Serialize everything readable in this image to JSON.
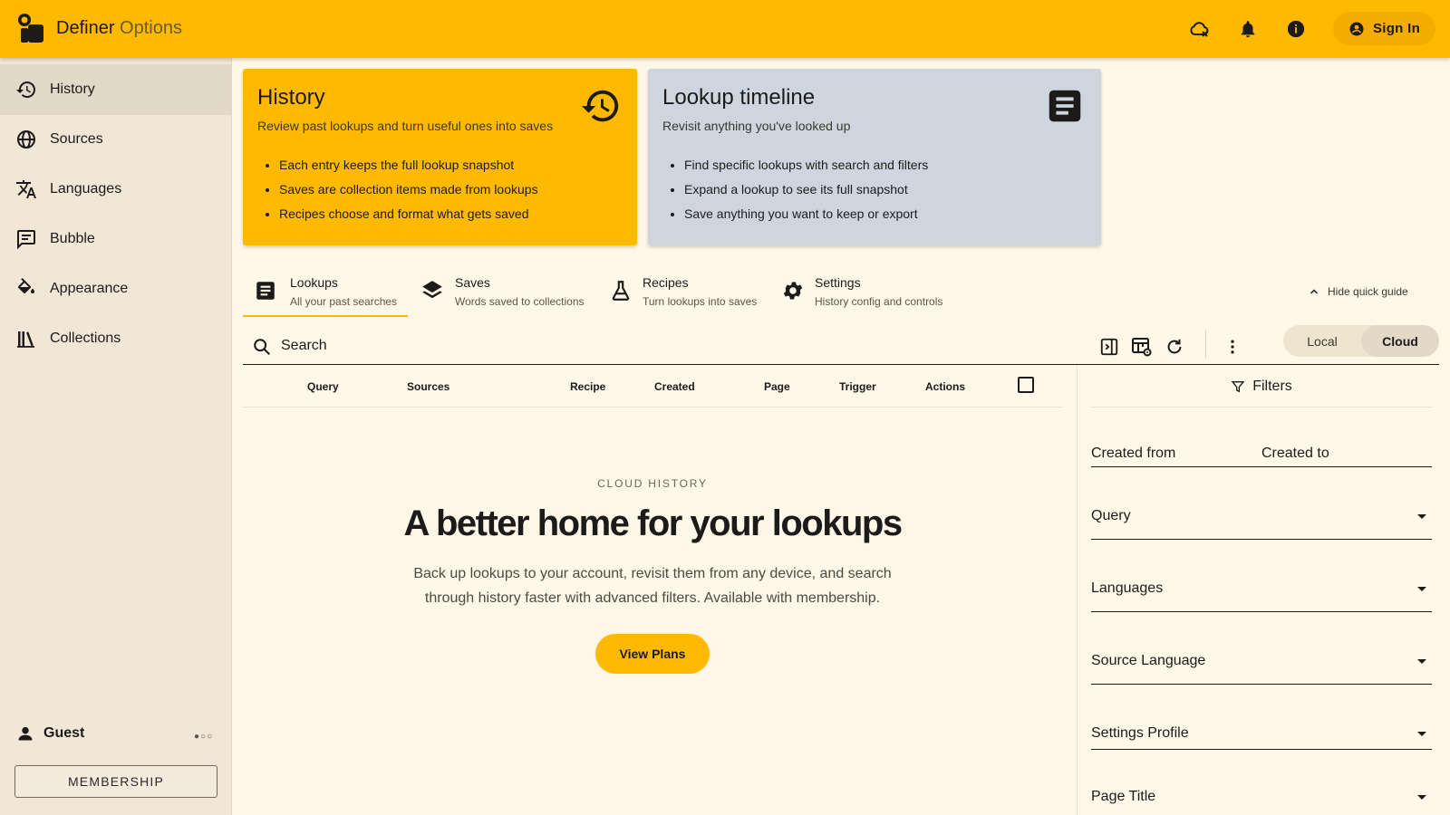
{
  "header": {
    "app_name": "Definer",
    "app_sub": "Options",
    "sign_in_label": "Sign In",
    "icons": [
      "cloud-off-icon",
      "bell-icon",
      "info-icon",
      "account-circle-icon"
    ]
  },
  "sidebar": {
    "items": [
      {
        "label": "History",
        "icon": "history-icon",
        "active": true
      },
      {
        "label": "Sources",
        "icon": "globe-icon"
      },
      {
        "label": "Languages",
        "icon": "translate-icon"
      },
      {
        "label": "Bubble",
        "icon": "chat-bubble-icon"
      },
      {
        "label": "Appearance",
        "icon": "paint-bucket-icon"
      },
      {
        "label": "Collections",
        "icon": "library-icon"
      }
    ],
    "user_name": "Guest",
    "membership_label": "MEMBERSHIP"
  },
  "cards": {
    "history": {
      "title": "History",
      "description": "Review past lookups and turn useful ones into saves",
      "bullets": [
        "Each entry keeps the full lookup snapshot",
        "Saves are collection items made from lookups",
        "Recipes choose and format what gets saved"
      ]
    },
    "timeline": {
      "title": "Lookup timeline",
      "description": "Revisit anything you've looked up",
      "bullets": [
        "Find specific lookups with search and filters",
        "Expand a lookup to see its full snapshot",
        "Save anything you want to keep or export"
      ]
    }
  },
  "tabs": [
    {
      "title": "Lookups",
      "subtitle": "All your past searches",
      "active": true
    },
    {
      "title": "Saves",
      "subtitle": "Words saved to collections"
    },
    {
      "title": "Recipes",
      "subtitle": "Turn lookups into saves"
    },
    {
      "title": "Settings",
      "subtitle": "History config and controls"
    }
  ],
  "hide_guide_label": "Hide quick guide",
  "search": {
    "placeholder": "Search"
  },
  "toggle": {
    "local": "Local",
    "cloud": "Cloud",
    "selected": "Cloud"
  },
  "table": {
    "columns": [
      "Query",
      "Sources",
      "Recipe",
      "Created",
      "Page",
      "Trigger",
      "Actions"
    ]
  },
  "empty_state": {
    "eyebrow": "CLOUD HISTORY",
    "headline": "A better home for your lookups",
    "body": "Back up lookups to your account, revisit them from any device, and search through history faster with advanced filters. Available with membership.",
    "cta": "View Plans"
  },
  "filters": {
    "title": "Filters",
    "created_from": "Created from",
    "created_to": "Created to",
    "fields": [
      "Query",
      "Languages",
      "Source Language",
      "Settings Profile",
      "Page Title"
    ]
  },
  "colors": {
    "accent": "#ffb900",
    "sidebar_bg": "#f2e6d6",
    "page_bg": "#fff8e8",
    "timeline_card": "#cfd5df"
  }
}
